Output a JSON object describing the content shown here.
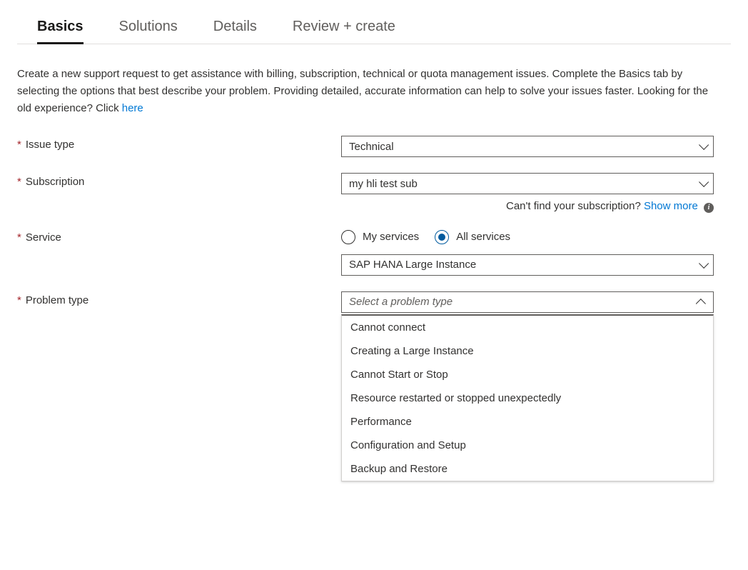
{
  "tabs": {
    "basics": "Basics",
    "solutions": "Solutions",
    "details": "Details",
    "review": "Review + create"
  },
  "intro": {
    "text1": "Create a new support request to get assistance with billing, subscription, technical or quota management issues. Complete the Basics tab by selecting the options that best describe your problem. Providing detailed, accurate information can help to solve your issues faster. Looking for the old experience? Click ",
    "link": "here"
  },
  "labels": {
    "issue_type": "Issue type",
    "subscription": "Subscription",
    "service": "Service",
    "problem_type": "Problem type"
  },
  "values": {
    "issue_type": "Technical",
    "subscription": "my hli test sub",
    "service_dropdown": "SAP HANA Large Instance",
    "problem_type_placeholder": "Select a problem type"
  },
  "subscription_help": {
    "text": "Can't find your subscription? ",
    "link": "Show more"
  },
  "service_radios": {
    "my_services": "My services",
    "all_services": "All services"
  },
  "problem_options": [
    "Cannot connect",
    "Creating a Large Instance",
    "Cannot Start or Stop",
    "Resource restarted or stopped unexpectedly",
    "Performance",
    "Configuration and Setup",
    "Backup and Restore"
  ]
}
